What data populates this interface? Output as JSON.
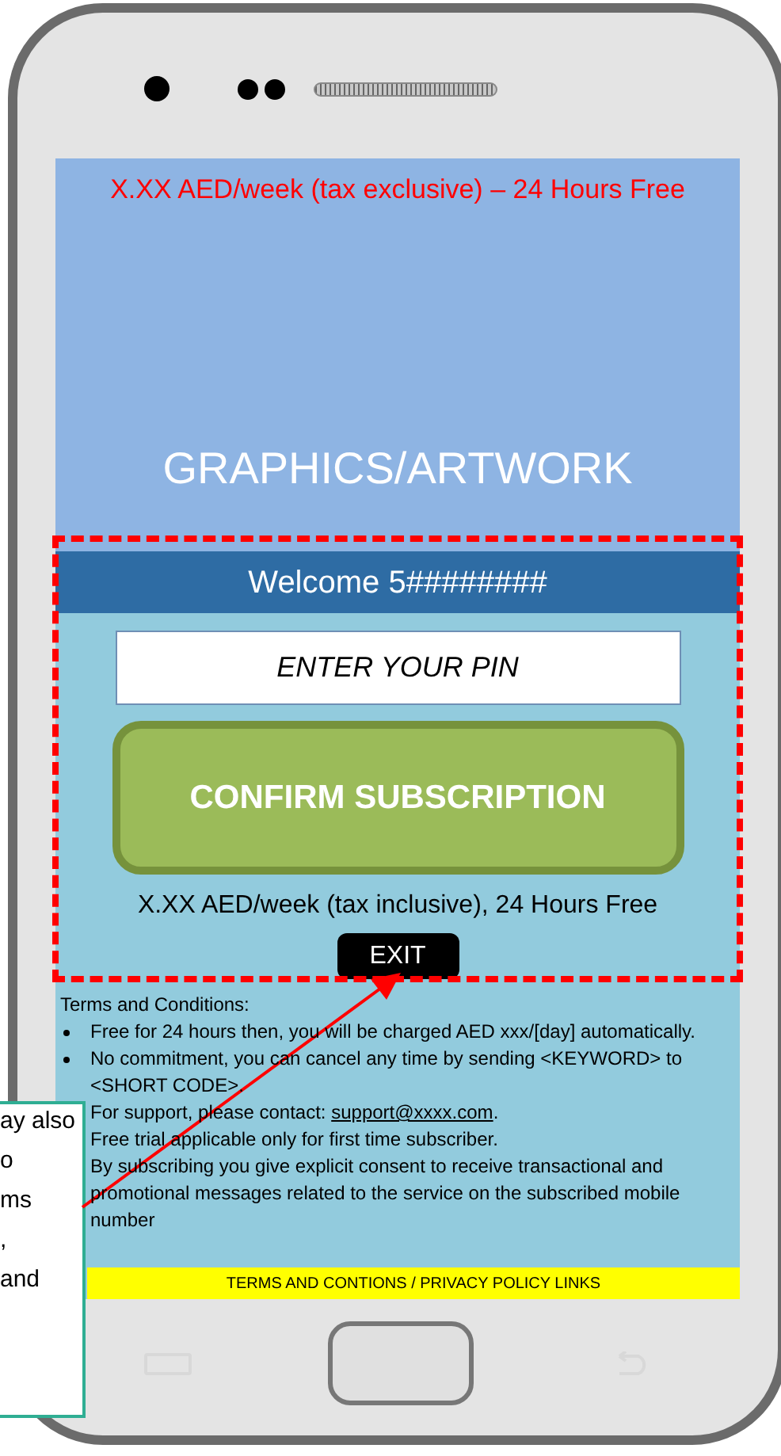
{
  "banner": {
    "price_note": "X.XX AED/week (tax exclusive) – 24 Hours Free",
    "artwork_label": "GRAPHICS/ARTWORK"
  },
  "welcome": "Welcome 5########",
  "pin_field": {
    "placeholder": "ENTER YOUR PIN"
  },
  "confirm_button": "CONFIRM SUBSCRIPTION",
  "price_info": "X.XX AED/week (tax inclusive), 24 Hours Free",
  "exit_button": "EXIT",
  "terms": {
    "heading": "Terms and Conditions:",
    "items": [
      {
        "kind": "bullet",
        "text": "Free for 24 hours then, you will be charged AED xxx/[day] automatically."
      },
      {
        "kind": "bullet",
        "text": "No commitment, you can cancel any time by sending <KEYWORD> to <SHORT CODE>."
      },
      {
        "kind": "plain",
        "text": "For support, please contact: ",
        "link": "support@xxxx.com",
        "after": "."
      },
      {
        "kind": "plain",
        "text": "Free trial applicable only for first time subscriber."
      },
      {
        "kind": "plain",
        "text": "By subscribing you give explicit consent to receive transactional and promotional messages related to the service on the subscribed mobile number"
      }
    ]
  },
  "footer_links": "TERMS AND CONTIONS / PRIVACY POLICY LINKS",
  "callout": {
    "lines": [
      "ay also",
      "o",
      "ms",
      ",",
      "and"
    ]
  }
}
